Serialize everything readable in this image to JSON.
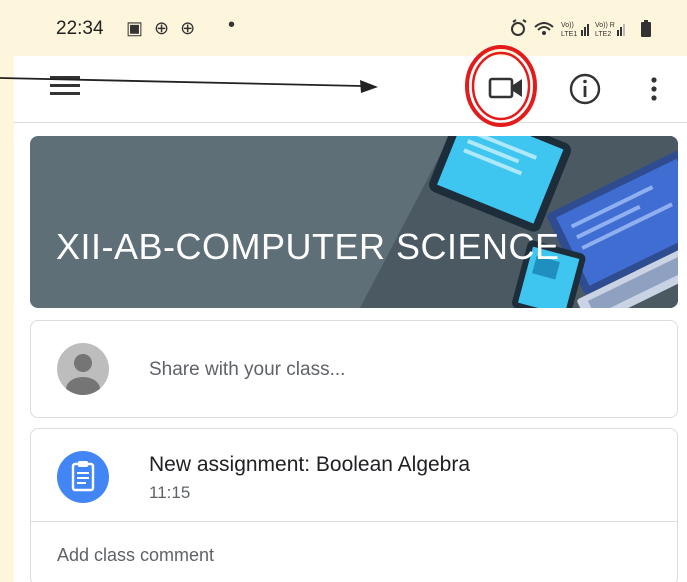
{
  "status_bar": {
    "time": "22:34",
    "left_icons": "▣ ⊕ ⊕"
  },
  "app_bar": {
    "menu_icon": "hamburger-menu-icon",
    "video_icon": "video-camera-icon",
    "info_icon": "info-icon",
    "more_icon": "more-vertical-icon"
  },
  "banner": {
    "title": "XII-AB-COMPUTER SCIENCE"
  },
  "share": {
    "placeholder": "Share with your class..."
  },
  "post": {
    "title": "New assignment: Boolean Algebra",
    "time": "11:15",
    "comment_label": "Add class comment"
  },
  "colors": {
    "banner": "#5e6f78",
    "accent_blue": "#4285f4",
    "highlight_red": "#e31b1b",
    "page_bg": "#fdf6dc"
  }
}
